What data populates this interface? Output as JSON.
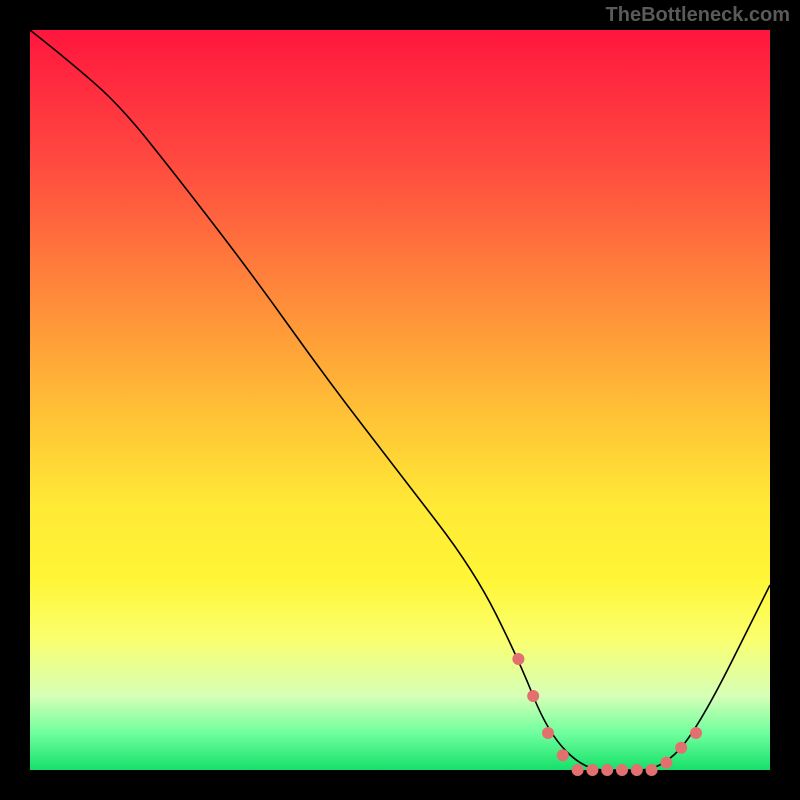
{
  "attribution": "TheBottleneck.com",
  "chart_data": {
    "type": "line",
    "title": "",
    "xlabel": "",
    "ylabel": "",
    "xlim": [
      0,
      100
    ],
    "ylim": [
      0,
      100
    ],
    "grid": false,
    "legend": false,
    "series": [
      {
        "name": "curve",
        "x": [
          0,
          5,
          12,
          20,
          30,
          40,
          50,
          60,
          66,
          70,
          75,
          80,
          85,
          90,
          100
        ],
        "y": [
          100,
          96,
          90,
          80,
          67,
          53,
          40,
          27,
          15,
          5,
          0,
          0,
          0,
          5,
          25
        ]
      }
    ],
    "highlight_dots": {
      "x": [
        66,
        68,
        70,
        72,
        74,
        76,
        78,
        80,
        82,
        84,
        86,
        88,
        90
      ],
      "y": [
        15,
        10,
        5,
        2,
        0,
        0,
        0,
        0,
        0,
        0,
        1,
        3,
        5
      ]
    },
    "background_gradient": {
      "top": "#ff163e",
      "middle": "#ffe836",
      "bottom": "#16e06a"
    }
  }
}
